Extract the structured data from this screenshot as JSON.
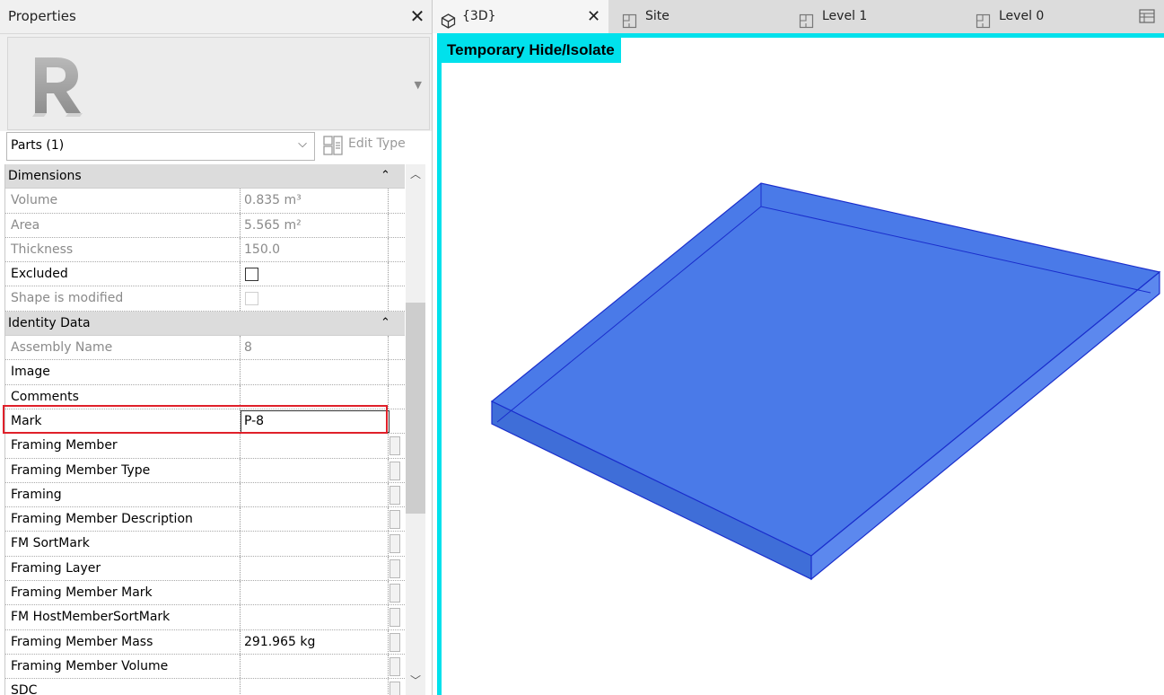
{
  "properties": {
    "title": "Properties",
    "type_selector": "Parts (1)",
    "edit_type_label": "Edit Type",
    "groups": [
      {
        "name": "Dimensions",
        "rows": [
          {
            "name": "Volume",
            "value": "0.835 m³",
            "readonly": true
          },
          {
            "name": "Area",
            "value": "5.565 m²",
            "readonly": true
          },
          {
            "name": "Thickness",
            "value": "150.0",
            "readonly": true
          },
          {
            "name": "Excluded",
            "value": "",
            "checkbox": true,
            "checked": false,
            "readonly": false
          },
          {
            "name": "Shape is modified",
            "value": "",
            "checkbox": true,
            "checked": false,
            "readonly": true
          }
        ]
      },
      {
        "name": "Identity Data",
        "rows": [
          {
            "name": "Assembly Name",
            "value": "8",
            "readonly": true
          },
          {
            "name": "Image",
            "value": ""
          },
          {
            "name": "Comments",
            "value": ""
          },
          {
            "name": "Mark",
            "value": "P-8",
            "editing": true
          },
          {
            "name": "Framing Member",
            "value": "",
            "button": true
          },
          {
            "name": "Framing Member Type",
            "value": "",
            "button": true
          },
          {
            "name": "Framing",
            "value": "",
            "button": true
          },
          {
            "name": "Framing Member Description",
            "value": "",
            "button": true
          },
          {
            "name": "FM SortMark",
            "value": "",
            "button": true
          },
          {
            "name": "Framing Layer",
            "value": "",
            "button": true
          },
          {
            "name": "Framing Member Mark",
            "value": "",
            "button": true
          },
          {
            "name": "FM HostMemberSortMark",
            "value": "",
            "button": true
          },
          {
            "name": "Framing Member Mass",
            "value": "291.965 kg",
            "button": true
          },
          {
            "name": "Framing Member Volume",
            "value": "",
            "button": true
          },
          {
            "name": "SDC",
            "value": "",
            "button": true
          }
        ]
      }
    ]
  },
  "tabs": [
    {
      "label": "{3D}",
      "icon": "3d-view-icon",
      "active": true,
      "closable": true
    },
    {
      "label": "Site",
      "icon": "floor-plan-icon"
    },
    {
      "label": "Level 1",
      "icon": "floor-plan-icon"
    },
    {
      "label": "Level 0",
      "icon": "floor-plan-icon"
    }
  ],
  "view": {
    "mode_label": "Temporary Hide/Isolate"
  },
  "colors": {
    "isolate_accent": "#00e1ec",
    "part_fill": "#4a7ae8",
    "highlight": "#e0202a"
  }
}
